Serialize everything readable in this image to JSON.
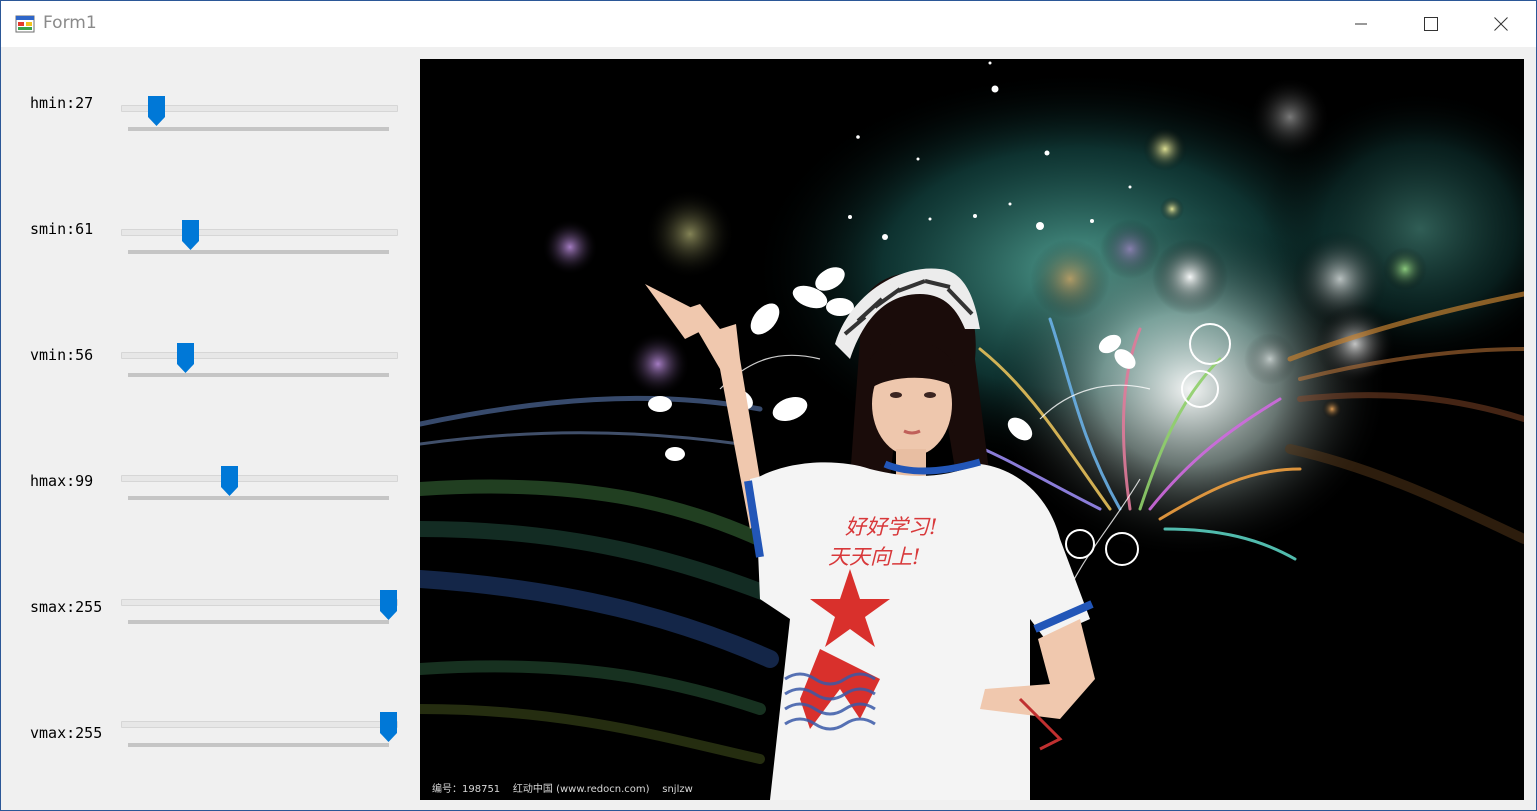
{
  "window": {
    "title": "Form1"
  },
  "controls": {
    "sliders": [
      {
        "name": "hmin",
        "label": "hmin:27",
        "value": 27,
        "max": 255
      },
      {
        "name": "smin",
        "label": "smin:61",
        "value": 61,
        "max": 255
      },
      {
        "name": "vmin",
        "label": "vmin:56",
        "value": 56,
        "max": 255
      },
      {
        "name": "hmax",
        "label": "hmax:99",
        "value": 99,
        "max": 255
      },
      {
        "name": "smax",
        "label": "smax:255",
        "value": 255,
        "max": 255
      },
      {
        "name": "vmax",
        "label": "vmax:255",
        "value": 255,
        "max": 255
      }
    ]
  },
  "picture": {
    "credit": "编号：198751    红动中国 (www.redocn.com)    snjlzw",
    "shirt_line1": "好好学习!",
    "shirt_line2": "天天向上!"
  },
  "colors": {
    "thumb": "#0078d7",
    "title_text": "#8a8a8a"
  },
  "icons": {
    "app": "form-app-icon",
    "minimize": "minimize-icon",
    "maximize": "maximize-icon",
    "close": "close-icon"
  }
}
